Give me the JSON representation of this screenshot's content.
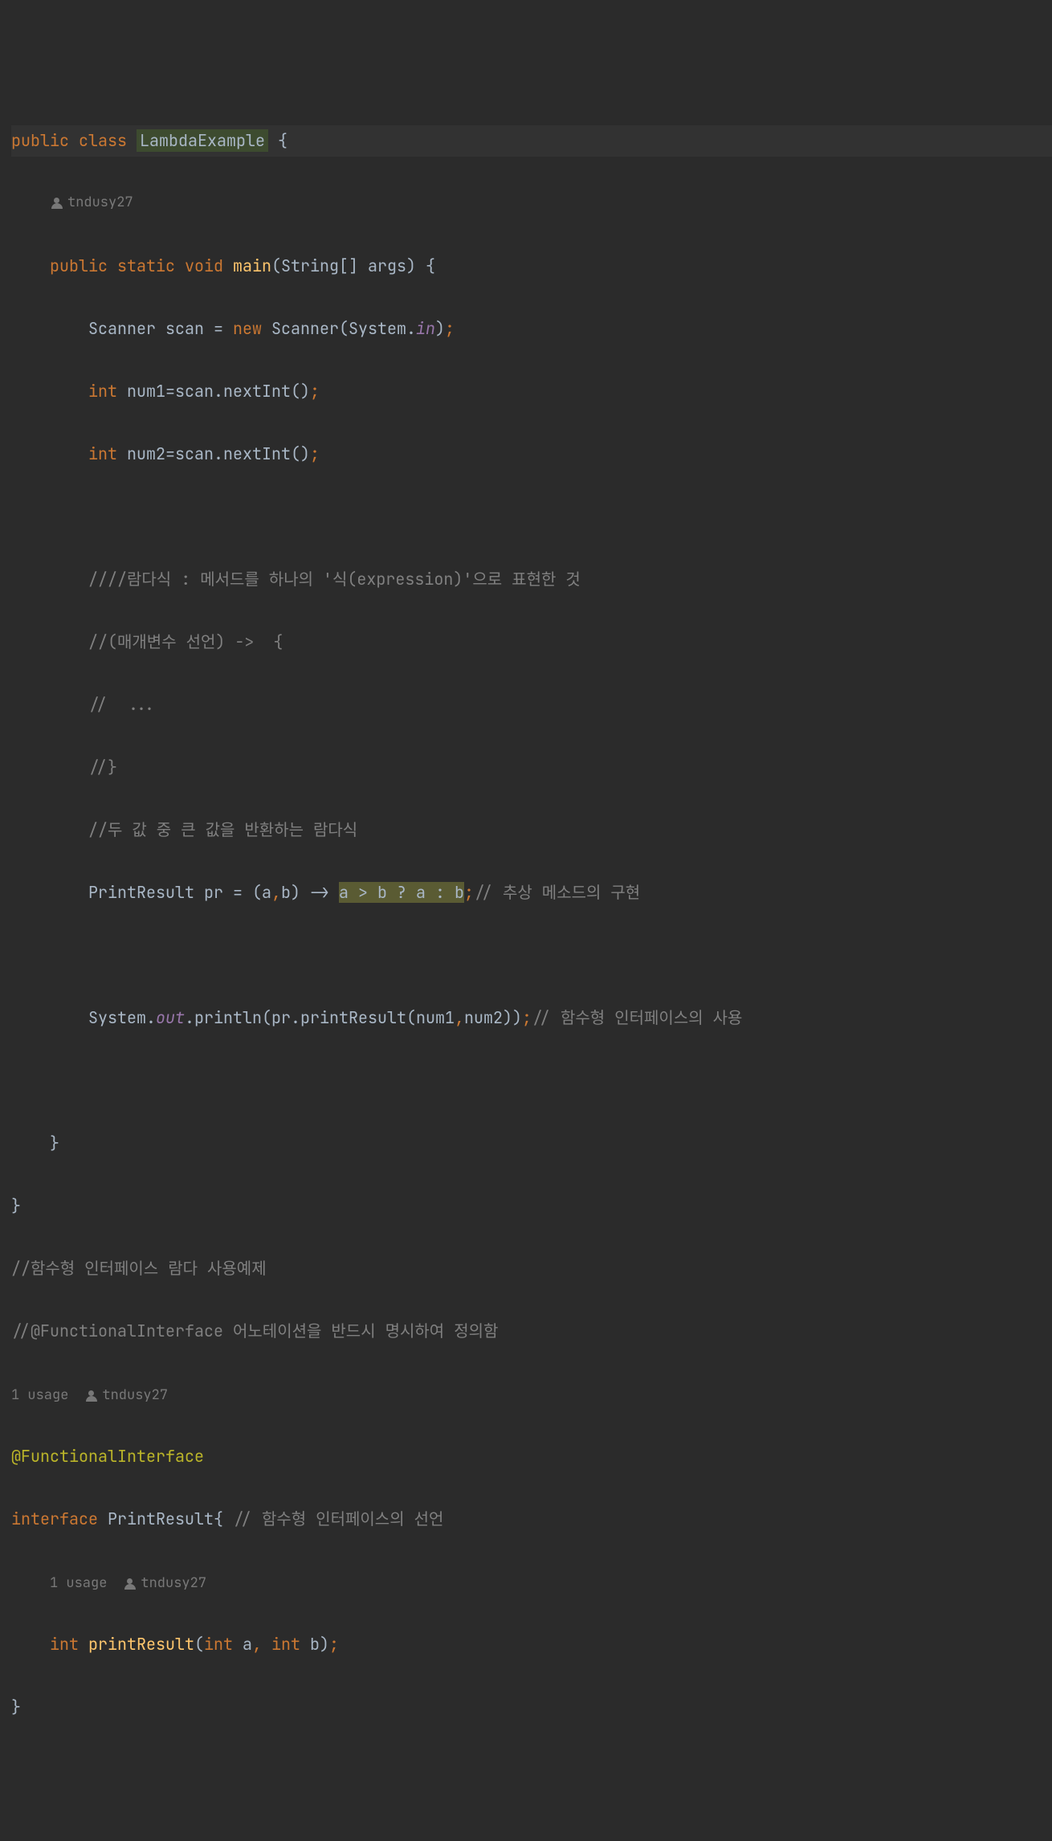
{
  "code": {
    "l1_public": "public",
    "l1_class": "class",
    "l1_name": "LambdaExample",
    "l1_brace": " {",
    "l2_author": "tndusy27",
    "l3_public": "public",
    "l3_static": "static",
    "l3_void": "void",
    "l3_main": "main",
    "l3_params": "(String[] args) {",
    "l4_type": "Scanner",
    "l4_var": " scan = ",
    "l4_new": "new",
    "l4_ctor": " Scanner(System.",
    "l4_in": "in",
    "l4_end": ")",
    "l4_semi": ";",
    "l5_int": "int",
    "l5_rest": " num1=scan.nextInt()",
    "l5_semi": ";",
    "l6_int": "int",
    "l6_rest": " num2=scan.nextInt()",
    "l6_semi": ";",
    "l8": "////람다식 : 메서드를 하나의 '식(expression)'으로 표현한 것",
    "l9": "//(매개변수 선언) ->  {",
    "l10": "//  ...",
    "l11": "//}",
    "l12": "//두 값 중 큰 값을 반환하는 람다식",
    "l13_a": "PrintResult pr = (a",
    "l13_comma": ",",
    "l13_b": "b) -> ",
    "l13_hl": "a > b ? a : b",
    "l13_semi": ";",
    "l13_c": "// 추상 메소드의 구현",
    "l15_a": "System.",
    "l15_out": "out",
    "l15_b": ".println(pr.printResult(num1",
    "l15_comma": ",",
    "l15_c": "num2))",
    "l15_semi": ";",
    "l15_d": "// 함수형 인터페이스의 사용",
    "l17": "}",
    "l18": "}",
    "l19": "//함수형 인터페이스 람다 사용예제",
    "l20": "//@FunctionalInterface 어노테이션을 반드시 명시하여 정의함",
    "l21_usage": "1 usage",
    "l21_author": "tndusy27",
    "l22": "@FunctionalInterface",
    "l23_interface": "interface",
    "l23_name": " PrintResult{ ",
    "l23_c": "// 함수형 인터페이스의 선언",
    "l24_usage": "1 usage",
    "l24_author": "tndusy27",
    "l25_int": "int",
    "l25_name": "printResult",
    "l25_p1": "(",
    "l25_int2": "int",
    "l25_a": " a",
    "l25_comma": ", ",
    "l25_int3": "int",
    "l25_b": " b)",
    "l25_semi": ";",
    "l26": "}"
  }
}
